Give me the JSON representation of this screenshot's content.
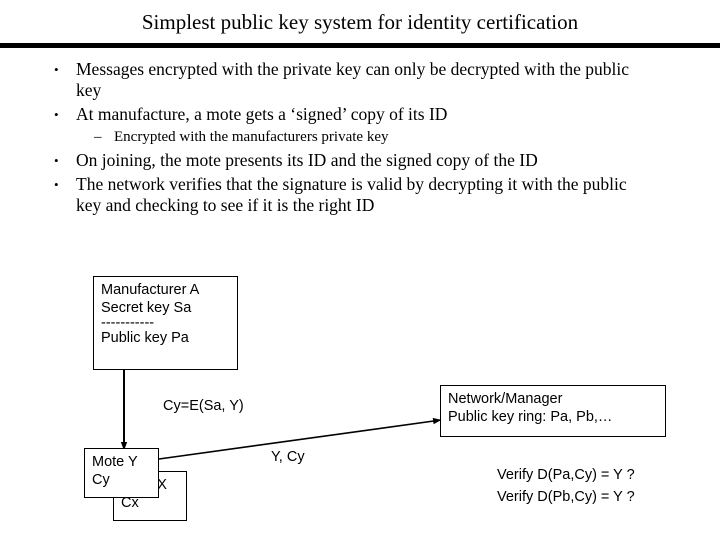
{
  "slide": {
    "title": "Simplest public key system for identity certification",
    "background_color": "#ffffff",
    "text_color": "#000000"
  },
  "body": {
    "bullets": [
      {
        "level": 1,
        "marker": "•",
        "text": "Messages encrypted with the private key can only be decrypted with the public key"
      },
      {
        "level": 1,
        "marker": "•",
        "text": "At manufacture, a mote gets a ‘signed’ copy of its ID"
      },
      {
        "level": 2,
        "marker": "–",
        "text": "Encrypted with the manufacturers private key"
      },
      {
        "level": 1,
        "marker": "•",
        "text": "On joining, the mote presents its ID and the signed copy of the ID"
      },
      {
        "level": 1,
        "marker": "•",
        "text": "The network verifies that the signature is valid by decrypting it with the public key and checking to see if it is the right ID"
      }
    ]
  },
  "diagram": {
    "manufacturer_box": {
      "line1": "Manufacturer A",
      "line2": "Secret key Sa",
      "divider": "-----------",
      "line3": "Public key Pa"
    },
    "mote_y_box": {
      "line1": "Mote Y",
      "line2": "Cy"
    },
    "mote_x_box": {
      "line1": "Mote X",
      "line2": "Cx"
    },
    "network_box": {
      "line1": "Network/Manager",
      "line2": "Public key ring: Pa, Pb,…"
    },
    "labels": {
      "cy_formula": "Cy=E(Sa, Y)",
      "transmission": "Y, Cy",
      "verify_a": "Verify D(Pa,Cy) = Y ?",
      "verify_b": "Verify D(Pb,Cy) = Y ?"
    }
  }
}
